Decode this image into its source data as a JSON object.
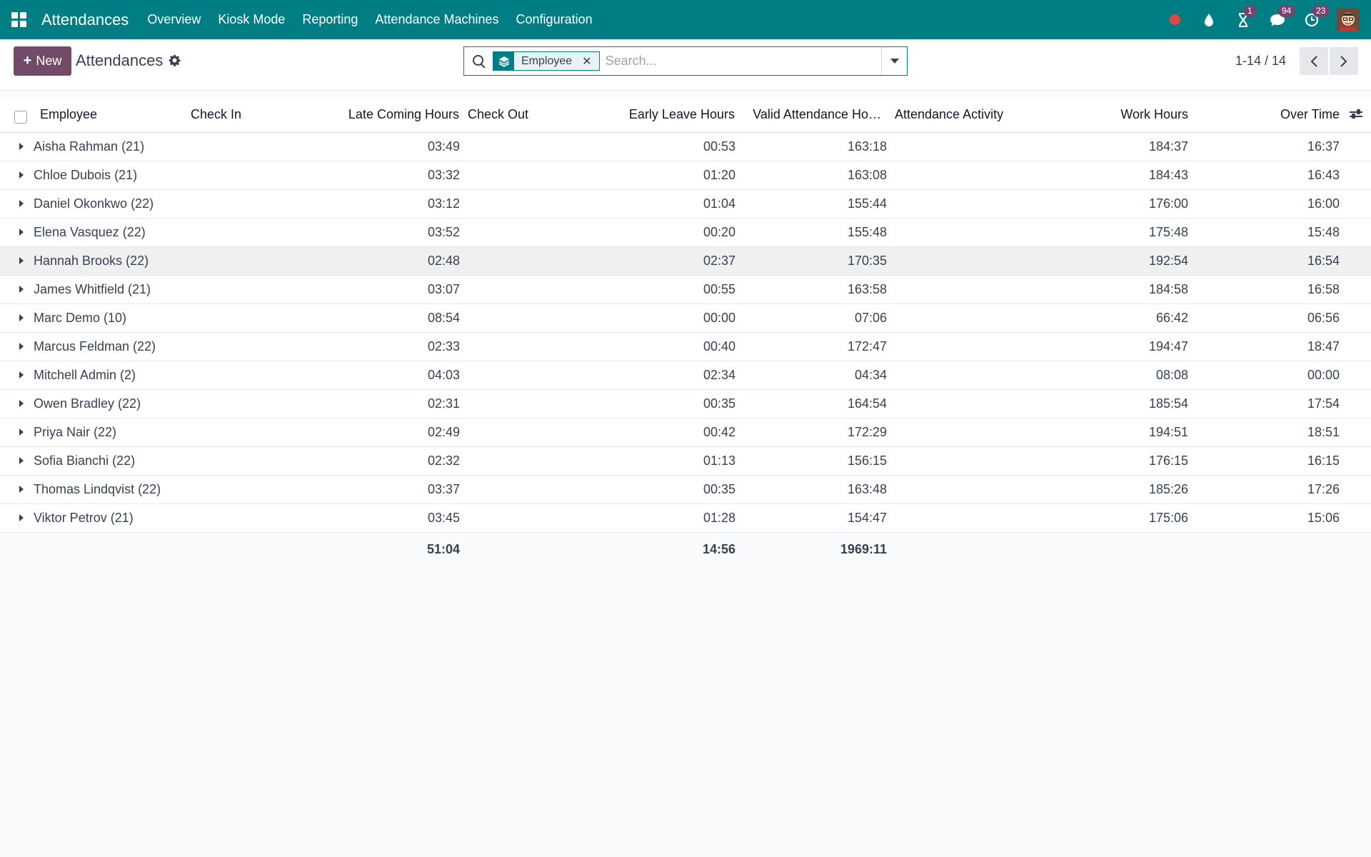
{
  "navbar": {
    "app_name": "Attendances",
    "menu": [
      "Overview",
      "Kiosk Mode",
      "Reporting",
      "Attendance Machines",
      "Configuration"
    ],
    "badges": {
      "activities": "1",
      "messages": "94",
      "clock": "23"
    }
  },
  "control": {
    "new_label": "New",
    "title": "Attendances",
    "search_placeholder": "Search...",
    "facet_label": "Employee",
    "pager": "1-14 / 14"
  },
  "columns": {
    "employee": "Employee",
    "check_in": "Check In",
    "late": "Late Coming Hours",
    "check_out": "Check Out",
    "early": "Early Leave Hours",
    "valid": "Valid Attendance Ho…",
    "activity": "Attendance Activity",
    "work": "Work Hours",
    "over": "Over Time"
  },
  "rows": [
    {
      "name": "Aisha Rahman (21)",
      "late": "03:49",
      "early": "00:53",
      "valid": "163:18",
      "work": "184:37",
      "over": "16:37"
    },
    {
      "name": "Chloe Dubois (21)",
      "late": "03:32",
      "early": "01:20",
      "valid": "163:08",
      "work": "184:43",
      "over": "16:43"
    },
    {
      "name": "Daniel Okonkwo (22)",
      "late": "03:12",
      "early": "01:04",
      "valid": "155:44",
      "work": "176:00",
      "over": "16:00"
    },
    {
      "name": "Elena Vasquez (22)",
      "late": "03:52",
      "early": "00:20",
      "valid": "155:48",
      "work": "175:48",
      "over": "15:48"
    },
    {
      "name": "Hannah Brooks (22)",
      "late": "02:48",
      "early": "02:37",
      "valid": "170:35",
      "work": "192:54",
      "over": "16:54"
    },
    {
      "name": "James Whitfield (21)",
      "late": "03:07",
      "early": "00:55",
      "valid": "163:58",
      "work": "184:58",
      "over": "16:58"
    },
    {
      "name": "Marc Demo (10)",
      "late": "08:54",
      "early": "00:00",
      "valid": "07:06",
      "work": "66:42",
      "over": "06:56"
    },
    {
      "name": "Marcus Feldman (22)",
      "late": "02:33",
      "early": "00:40",
      "valid": "172:47",
      "work": "194:47",
      "over": "18:47"
    },
    {
      "name": "Mitchell Admin (2)",
      "late": "04:03",
      "early": "02:34",
      "valid": "04:34",
      "work": "08:08",
      "over": "00:00"
    },
    {
      "name": "Owen Bradley (22)",
      "late": "02:31",
      "early": "00:35",
      "valid": "164:54",
      "work": "185:54",
      "over": "17:54"
    },
    {
      "name": "Priya Nair (22)",
      "late": "02:49",
      "early": "00:42",
      "valid": "172:29",
      "work": "194:51",
      "over": "18:51"
    },
    {
      "name": "Sofia Bianchi (22)",
      "late": "02:32",
      "early": "01:13",
      "valid": "156:15",
      "work": "176:15",
      "over": "16:15"
    },
    {
      "name": "Thomas Lindqvist (22)",
      "late": "03:37",
      "early": "00:35",
      "valid": "163:48",
      "work": "185:26",
      "over": "17:26"
    },
    {
      "name": "Viktor Petrov (21)",
      "late": "03:45",
      "early": "01:28",
      "valid": "154:47",
      "work": "175:06",
      "over": "15:06"
    }
  ],
  "totals": {
    "late": "51:04",
    "early": "14:56",
    "valid": "1969:11"
  }
}
